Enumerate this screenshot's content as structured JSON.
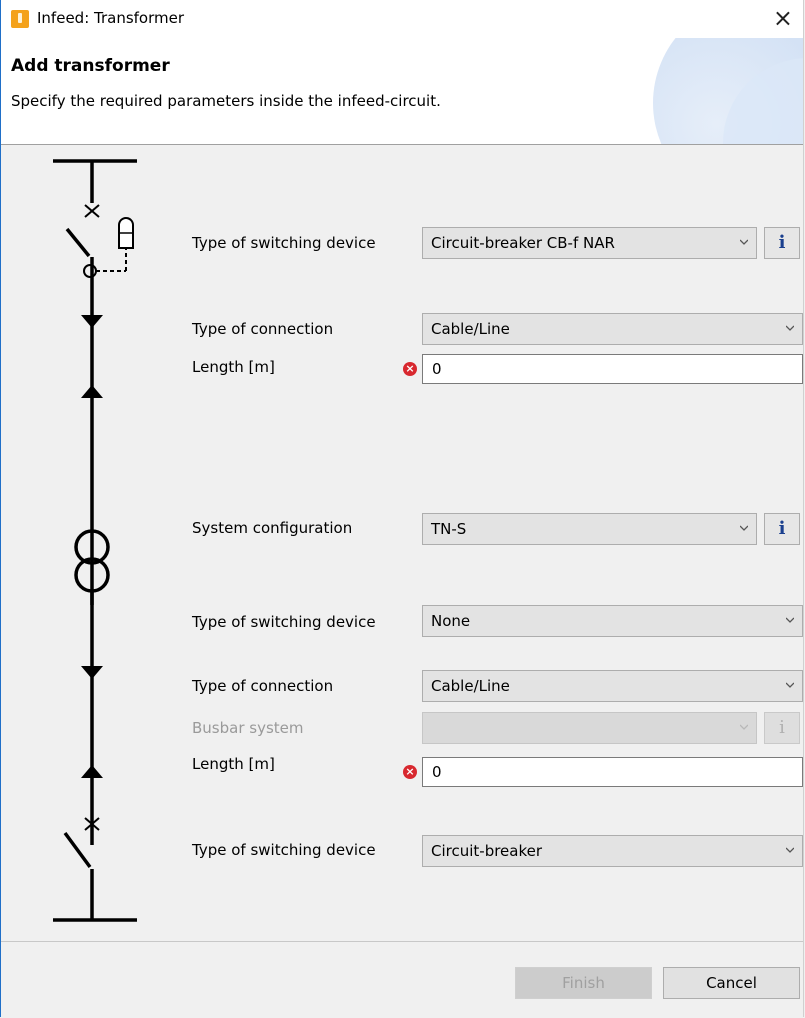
{
  "window": {
    "title": "Infeed: Transformer",
    "icon": "transformer-app-icon",
    "close_symbol": "×"
  },
  "header": {
    "title": "Add transformer",
    "description": "Specify the required parameters inside the infeed-circuit."
  },
  "form": {
    "sw1": {
      "label": "Type of switching device",
      "value": "Circuit-breaker CB-f NAR",
      "info": "i"
    },
    "conn1": {
      "label": "Type of connection",
      "value": "Cable/Line"
    },
    "len1": {
      "label": "Length [m]",
      "value": "0",
      "error_symbol": "×"
    },
    "syscfg": {
      "label": "System configuration",
      "value": "TN-S",
      "info": "i"
    },
    "sw2": {
      "label": "Type of switching device",
      "value": "None"
    },
    "conn2": {
      "label": "Type of connection",
      "value": "Cable/Line"
    },
    "busbar": {
      "label": "Busbar system",
      "value": "",
      "info": "i"
    },
    "len2": {
      "label": "Length [m]",
      "value": "0",
      "error_symbol": "×"
    },
    "sw3": {
      "label": "Type of switching device",
      "value": "Circuit-breaker"
    }
  },
  "footer": {
    "finish_label": "Finish",
    "cancel_label": "Cancel"
  },
  "colors": {
    "accent": "#1f6fc8",
    "error": "#d8282f",
    "info": "#1a3f8e",
    "app_icon": "#f4a21b"
  }
}
